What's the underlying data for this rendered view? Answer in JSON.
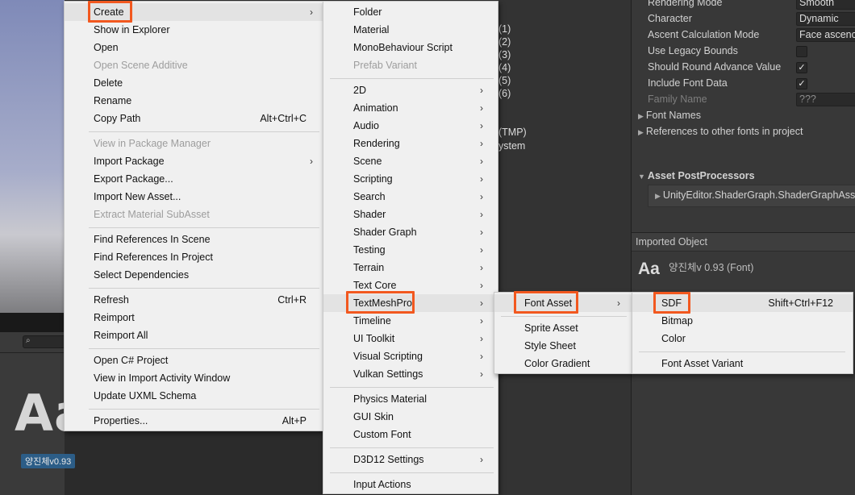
{
  "background": {
    "project_search_icon": "search-icon",
    "preview_text": "Aa",
    "asset_label": "양진체v0.93",
    "center_lines": [
      "(1)",
      "(2)",
      "(3)",
      "(4)",
      "(5)",
      "(6)",
      "(TMP)",
      "ystem"
    ]
  },
  "inspector": {
    "rendering_mode_label": "Rendering Mode",
    "rendering_mode_value": "Smooth",
    "character_label": "Character",
    "character_value": "Dynamic",
    "ascent_label": "Ascent Calculation Mode",
    "ascent_value": "Face ascenc",
    "legacy_bounds_label": "Use Legacy Bounds",
    "round_advance_label": "Should Round Advance Value",
    "include_font_data_label": "Include Font Data",
    "family_name_label": "Family Name",
    "family_name_value": "???",
    "font_names_label": "Font Names",
    "references_label": "References to other fonts in project",
    "postprocessors_label": "Asset PostProcessors",
    "postprocessor_item": "UnityEditor.ShaderGraph.ShaderGraphAss",
    "imported_object_label": "Imported Object",
    "preview_text": "Aa",
    "object_name": "양진체v 0.93 (Font)"
  },
  "menu_main": {
    "create": "Create",
    "show_in_explorer": "Show in Explorer",
    "open": "Open",
    "open_scene_additive": "Open Scene Additive",
    "delete": "Delete",
    "rename": "Rename",
    "copy_path": "Copy Path",
    "copy_path_shortcut": "Alt+Ctrl+C",
    "view_in_package_manager": "View in Package Manager",
    "import_package": "Import Package",
    "export_package": "Export Package...",
    "import_new_asset": "Import New Asset...",
    "extract_material_subasset": "Extract Material SubAsset",
    "find_refs_scene": "Find References In Scene",
    "find_refs_project": "Find References In Project",
    "select_dependencies": "Select Dependencies",
    "refresh": "Refresh",
    "refresh_shortcut": "Ctrl+R",
    "reimport": "Reimport",
    "reimport_all": "Reimport All",
    "open_csharp_project": "Open C# Project",
    "view_import_activity": "View in Import Activity Window",
    "update_uxml_schema": "Update UXML Schema",
    "properties": "Properties...",
    "properties_shortcut": "Alt+P"
  },
  "menu_create": {
    "folder": "Folder",
    "material": "Material",
    "monobehaviour_script": "MonoBehaviour Script",
    "prefab_variant": "Prefab Variant",
    "d2": "2D",
    "animation": "Animation",
    "audio": "Audio",
    "rendering": "Rendering",
    "scene": "Scene",
    "scripting": "Scripting",
    "search": "Search",
    "shader": "Shader",
    "shader_graph": "Shader Graph",
    "testing": "Testing",
    "terrain": "Terrain",
    "text_core": "Text Core",
    "textmeshpro": "TextMeshPro",
    "timeline": "Timeline",
    "ui_toolkit": "UI Toolkit",
    "visual_scripting": "Visual Scripting",
    "vulkan_settings": "Vulkan Settings",
    "physics_material": "Physics Material",
    "gui_skin": "GUI Skin",
    "custom_font": "Custom Font",
    "d3d12_settings": "D3D12 Settings",
    "input_actions": "Input Actions"
  },
  "menu_tmp": {
    "font_asset": "Font Asset",
    "sprite_asset": "Sprite Asset",
    "style_sheet": "Style Sheet",
    "color_gradient": "Color Gradient"
  },
  "menu_font_asset": {
    "sdf": "SDF",
    "sdf_shortcut": "Shift+Ctrl+F12",
    "bitmap": "Bitmap",
    "color": "Color",
    "font_asset_variant": "Font Asset Variant"
  },
  "colors": {
    "callout": "#f2581f",
    "menu_background": "#f0f0f0",
    "inspector_background": "#383838",
    "asset_label_background": "#2c5d87"
  },
  "glyphs": {
    "submenu_arrow": "›",
    "check": "✓",
    "fold_collapsed": "▶",
    "fold_expanded": "▼",
    "magnifier": "⌕"
  }
}
